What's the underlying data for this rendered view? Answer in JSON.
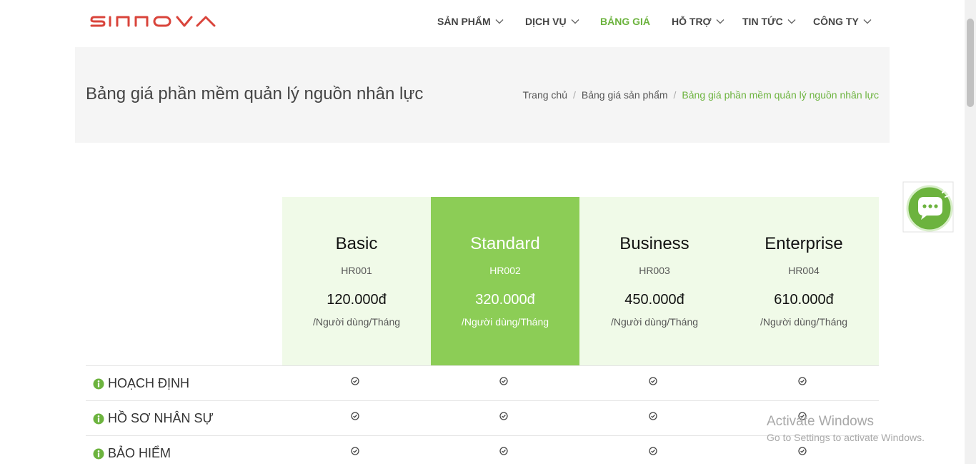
{
  "brand": {
    "name": "SINNOVA",
    "color": "#d9443b"
  },
  "nav": [
    {
      "label": "SẢN PHẨM",
      "has_dropdown": true,
      "active": false
    },
    {
      "label": "DỊCH VỤ",
      "has_dropdown": true,
      "active": false
    },
    {
      "label": "BẢNG GIÁ",
      "has_dropdown": false,
      "active": true
    },
    {
      "label": "HỖ TRỢ",
      "has_dropdown": true,
      "active": false
    },
    {
      "label": "TIN TỨC",
      "has_dropdown": true,
      "active": false
    },
    {
      "label": "CÔNG TY",
      "has_dropdown": true,
      "active": false
    }
  ],
  "page": {
    "title": "Bảng giá phần mềm quản lý nguồn nhân lực",
    "breadcrumb": [
      "Trang chủ",
      "Bảng giá sản phẩm",
      "Bảng giá phần mềm quản lý nguồn nhân lực"
    ]
  },
  "plans": [
    {
      "name": "Basic",
      "code": "HR001",
      "price": "120.000đ",
      "unit": "/Người dùng/Tháng",
      "featured": false
    },
    {
      "name": "Standard",
      "code": "HR002",
      "price": "320.000đ",
      "unit": "/Người dùng/Tháng",
      "featured": true
    },
    {
      "name": "Business",
      "code": "HR003",
      "price": "450.000đ",
      "unit": "/Người dùng/Tháng",
      "featured": false
    },
    {
      "name": "Enterprise",
      "code": "HR004",
      "price": "610.000đ",
      "unit": "/Người dùng/Tháng",
      "featured": false
    }
  ],
  "features": [
    {
      "label": "HOẠCH ĐỊNH",
      "included": [
        true,
        true,
        true,
        true
      ]
    },
    {
      "label": "HỒ SƠ NHÂN SỰ",
      "included": [
        true,
        true,
        true,
        true
      ]
    },
    {
      "label": "BẢO HIỂM",
      "included": [
        true,
        true,
        true,
        true
      ]
    }
  ],
  "watermark": {
    "line1": "Activate Windows",
    "line2": "Go to Settings to activate Windows."
  },
  "colors": {
    "accent": "#6cb33e",
    "featured_bg": "#8ccd56",
    "plans_bg": "#f0fae8",
    "banner_bg": "#f5f5f5"
  }
}
